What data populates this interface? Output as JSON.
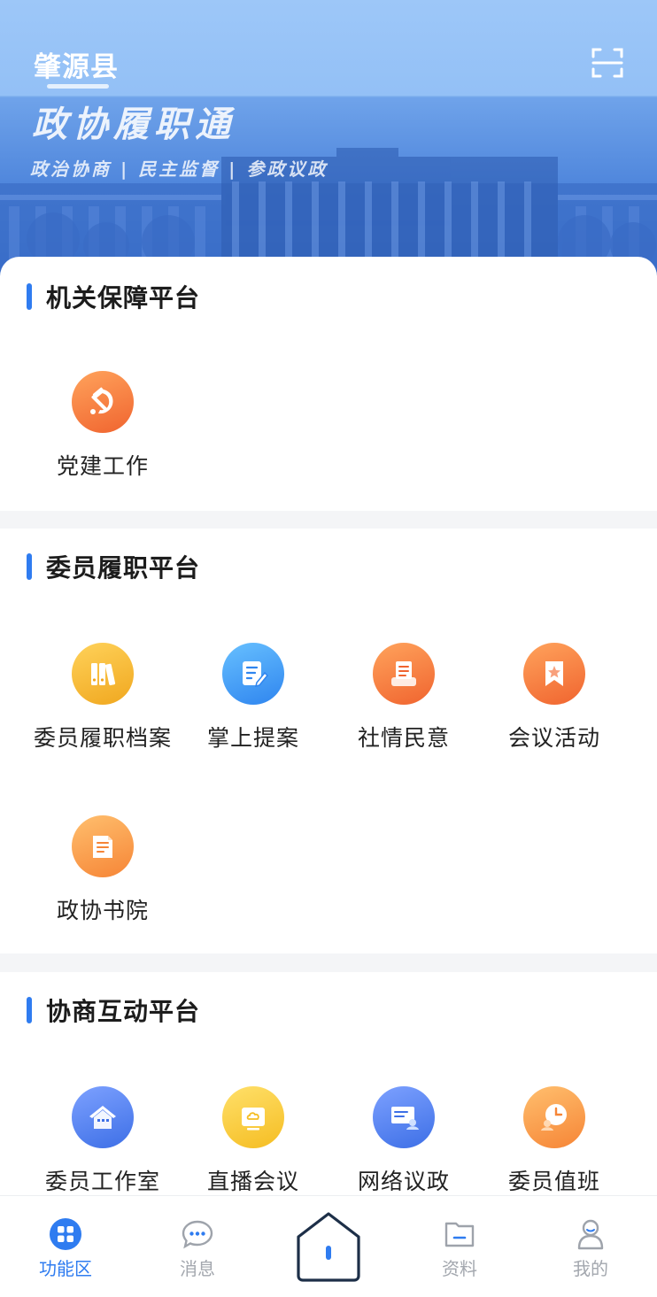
{
  "header": {
    "county": "肇源县",
    "banner_title": "政协履职通",
    "banner_subtitle": "政治协商 | 民主监督 | 参政议政",
    "scan_icon": "scan-icon"
  },
  "sections": [
    {
      "title": "机关保障平台",
      "items": [
        {
          "label": "党建工作",
          "icon": "party-emblem-icon",
          "color": "#f2692f"
        }
      ]
    },
    {
      "title": "委员履职平台",
      "items": [
        {
          "label": "委员履职档案",
          "icon": "binders-icon",
          "color": "#f0a71f"
        },
        {
          "label": "掌上提案",
          "icon": "edit-document-icon",
          "color": "#2f85ef"
        },
        {
          "label": "社情民意",
          "icon": "printer-report-icon",
          "color": "#f0642f"
        },
        {
          "label": "会议活动",
          "icon": "bookmark-star-icon",
          "color": "#f0642f"
        },
        {
          "label": "政协书院",
          "icon": "book-icon",
          "color": "#f68536"
        }
      ]
    },
    {
      "title": "协商互动平台",
      "items": [
        {
          "label": "委员工作室",
          "icon": "house-icon",
          "color": "#3d6fe6"
        },
        {
          "label": "直播会议",
          "icon": "live-screen-icon",
          "color": "#f5bd22"
        },
        {
          "label": "网络议政",
          "icon": "monitor-user-icon",
          "color": "#3d6fe6"
        },
        {
          "label": "委员值班",
          "icon": "clock-user-icon",
          "color": "#f68536"
        }
      ]
    }
  ],
  "tabbar": {
    "tabs": [
      {
        "label": "功能区",
        "icon": "grid-icon",
        "active": true
      },
      {
        "label": "消息",
        "icon": "chat-bubble-icon",
        "active": false
      },
      {
        "label": "",
        "icon": "home-icon",
        "active": false
      },
      {
        "label": "资料",
        "icon": "folder-icon",
        "active": false
      },
      {
        "label": "我的",
        "icon": "person-icon",
        "active": false
      }
    ],
    "active_color": "#2f7cf0",
    "inactive_color": "#a3a7ae"
  }
}
